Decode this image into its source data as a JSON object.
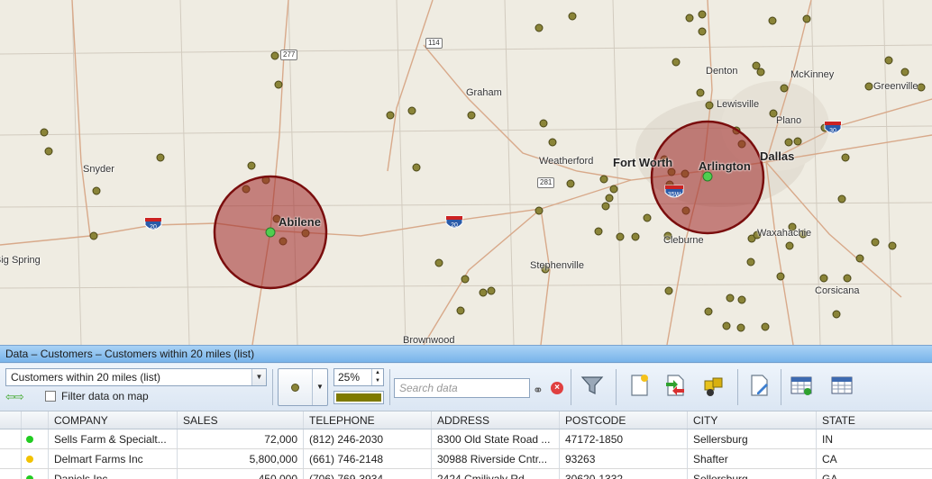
{
  "map": {
    "labels": [
      {
        "text": "Graham",
        "cls": "small"
      },
      {
        "text": "Denton",
        "cls": "small"
      },
      {
        "text": "McKinney",
        "cls": "small"
      },
      {
        "text": "Greenville",
        "cls": "small"
      },
      {
        "text": "Lewisville",
        "cls": "small"
      },
      {
        "text": "Plano",
        "cls": "small"
      },
      {
        "text": "Snyder",
        "cls": "small"
      },
      {
        "text": "Weatherford",
        "cls": "small"
      },
      {
        "text": "Fort Worth",
        "cls": "big"
      },
      {
        "text": "Arlington",
        "cls": "big"
      },
      {
        "text": "Dallas",
        "cls": "big"
      },
      {
        "text": "Abilene",
        "cls": "big"
      },
      {
        "text": "Cleburne",
        "cls": "small"
      },
      {
        "text": "Waxahachie",
        "cls": "small"
      },
      {
        "text": "Big Spring",
        "cls": "small"
      },
      {
        "text": "Stephenville",
        "cls": "small"
      },
      {
        "text": "Corsicana",
        "cls": "small"
      },
      {
        "text": "Brownwood",
        "cls": "small"
      }
    ],
    "shields": [
      "114",
      "277",
      "281"
    ],
    "interstates": [
      "20",
      "20",
      "30",
      "35W"
    ]
  },
  "panel": {
    "title": "Data – Customers – Customers within 20 miles (list)",
    "dropdown_value": "Customers within 20 miles (list)",
    "filter_label": "Filter data on map",
    "size_percent": "25%",
    "symbol_color": "#7e7a00",
    "search_placeholder": "Search data"
  },
  "table": {
    "columns": [
      "COMPANY",
      "SALES",
      "TELEPHONE",
      "ADDRESS",
      "POSTCODE",
      "CITY",
      "STATE"
    ],
    "rows": [
      {
        "status": "#22cc22",
        "company": "Sells Farm & Specialt...",
        "sales": "72,000",
        "telephone": "(812) 246-2030",
        "address": "8300 Old State Road ...",
        "postcode": "47172-1850",
        "city": "Sellersburg",
        "state": "IN"
      },
      {
        "status": "#f2c200",
        "company": "Delmart Farms Inc",
        "sales": "5,800,000",
        "telephone": "(661) 746-2148",
        "address": "30988 Riverside Cntr...",
        "postcode": "93263",
        "city": "Shafter",
        "state": "CA"
      },
      {
        "status": "#22cc22",
        "company": "Daniels Inc",
        "sales": "450,000",
        "telephone": "(706) 769-3934",
        "address": "2424 Cmilivaly Rd",
        "postcode": "30620-1332",
        "city": "Sellersburg",
        "state": "GA"
      }
    ]
  }
}
